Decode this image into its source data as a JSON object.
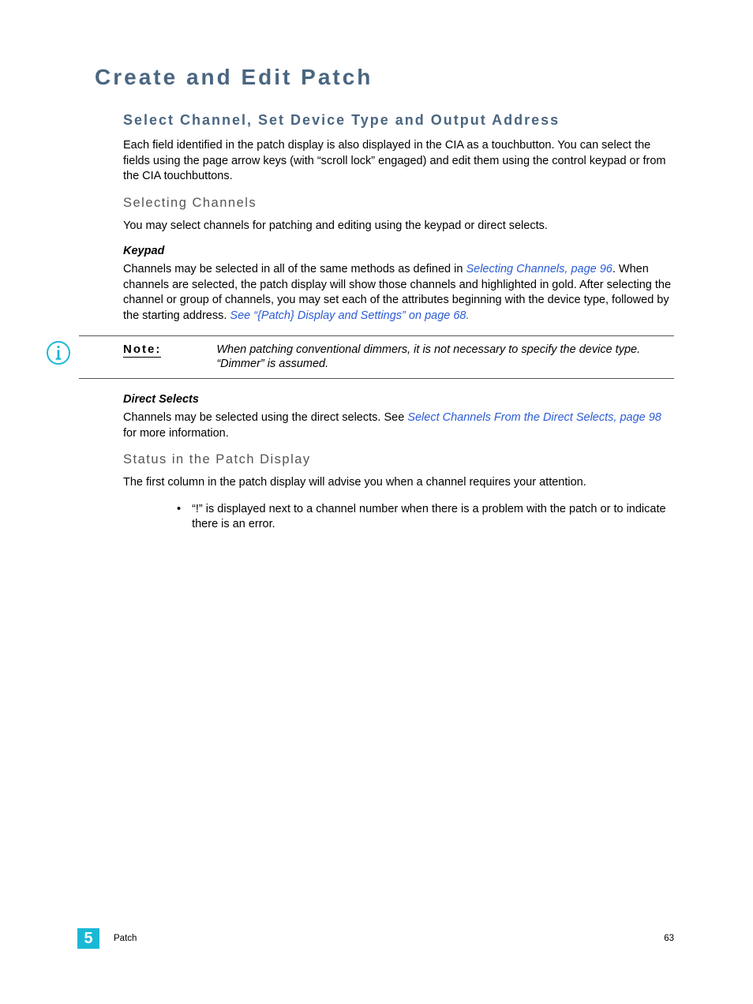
{
  "h1": "Create and Edit Patch",
  "h2": "Select Channel, Set Device Type and Output Address",
  "p1": "Each field identified in the patch display is also displayed in the CIA as a touchbutton. You can select the fields using the page arrow keys (with “scroll lock” engaged) and edit them using the control keypad or from the CIA touchbuttons.",
  "h3a": "Selecting Channels",
  "p2": "You may select channels for patching and editing using the keypad or direct selects.",
  "h4a": "Keypad",
  "p3a": "Channels may be selected in all of the same methods as defined in ",
  "link1": "Selecting Channels, page 96",
  "p3b": ". When channels are selected, the patch display will show those channels and highlighted in gold. After selecting the channel or group of channels, you may set each of the attributes beginning with the device type, followed by the starting address. ",
  "link2": "See “{Patch} Display and Settings” on page 68.",
  "note_label": "Note:",
  "note_text": "When patching conventional dimmers, it is not necessary to specify the device type. “Dimmer” is assumed.",
  "h4b": "Direct Selects",
  "p4a": "Channels may be selected using the direct selects. See ",
  "link3": "Select Channels From the Direct Selects, page 98",
  "p4b": " for more information.",
  "h3b": "Status in the Patch Display",
  "p5": "The first column in the patch display will advise you when a channel requires your attention.",
  "bullet1": "“!” is displayed next to a channel number when there is a problem with the patch or to indicate there is an error.",
  "footer_chapter": "5",
  "footer_title": "Patch",
  "page_num": "63"
}
